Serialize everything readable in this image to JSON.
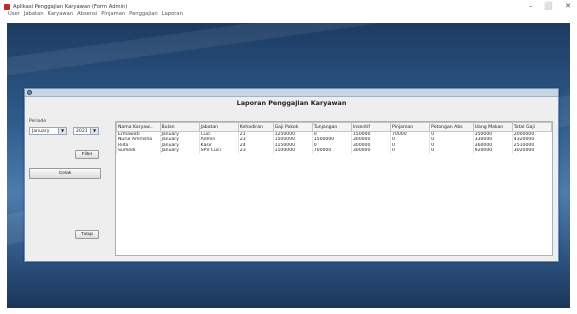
{
  "window": {
    "title": "Aplikasi Penggajian Karyawan (Form Admin)",
    "minimize": "–",
    "maximize": "⬜",
    "close": "✕"
  },
  "menu": [
    "User",
    "Jabatan",
    "Karyawan",
    "Absensi",
    "Pinjaman",
    "Penggajian",
    "Laporan"
  ],
  "report": {
    "title": "Laporan Penggajian Karyawan",
    "periode_label": "Periode",
    "month_value": "January",
    "year_value": "2021",
    "filter_label": "Filter",
    "print_label": "Cetak",
    "close_label": "Tutup"
  },
  "table": {
    "columns": [
      "Nama Karyaw...",
      "Bulan",
      "Jabatan",
      "Kehadiran",
      "Gaji Pokok",
      "Tunjangan",
      "Insentif",
      "Pinjaman",
      "Potongan Abs",
      "Uang Makan",
      "Total Gaji"
    ],
    "rows": [
      [
        "Ermawati",
        "January",
        "Cuci",
        "21",
        "1250000",
        "0",
        "150000",
        "70000",
        "0",
        "350000",
        "2000000"
      ],
      [
        "Nurul Amrlisha",
        "January",
        "Admin",
        "23",
        "1500000",
        "1500000",
        "300000",
        "0",
        "0",
        "330000",
        "4320000"
      ],
      [
        "Rida",
        "January",
        "Kasir",
        "24",
        "1150000",
        "0",
        "300000",
        "0",
        "0",
        "360000",
        "2510000"
      ],
      [
        "Sumedi",
        "January",
        "SPV Cuci",
        "23",
        "1100000",
        "700000",
        "300000",
        "0",
        "0",
        "920000",
        "3020000"
      ]
    ]
  },
  "colors": {
    "desktop": "#2f5c8c",
    "panel": "#eeeeee",
    "window_red_icon": "#c62828"
  }
}
